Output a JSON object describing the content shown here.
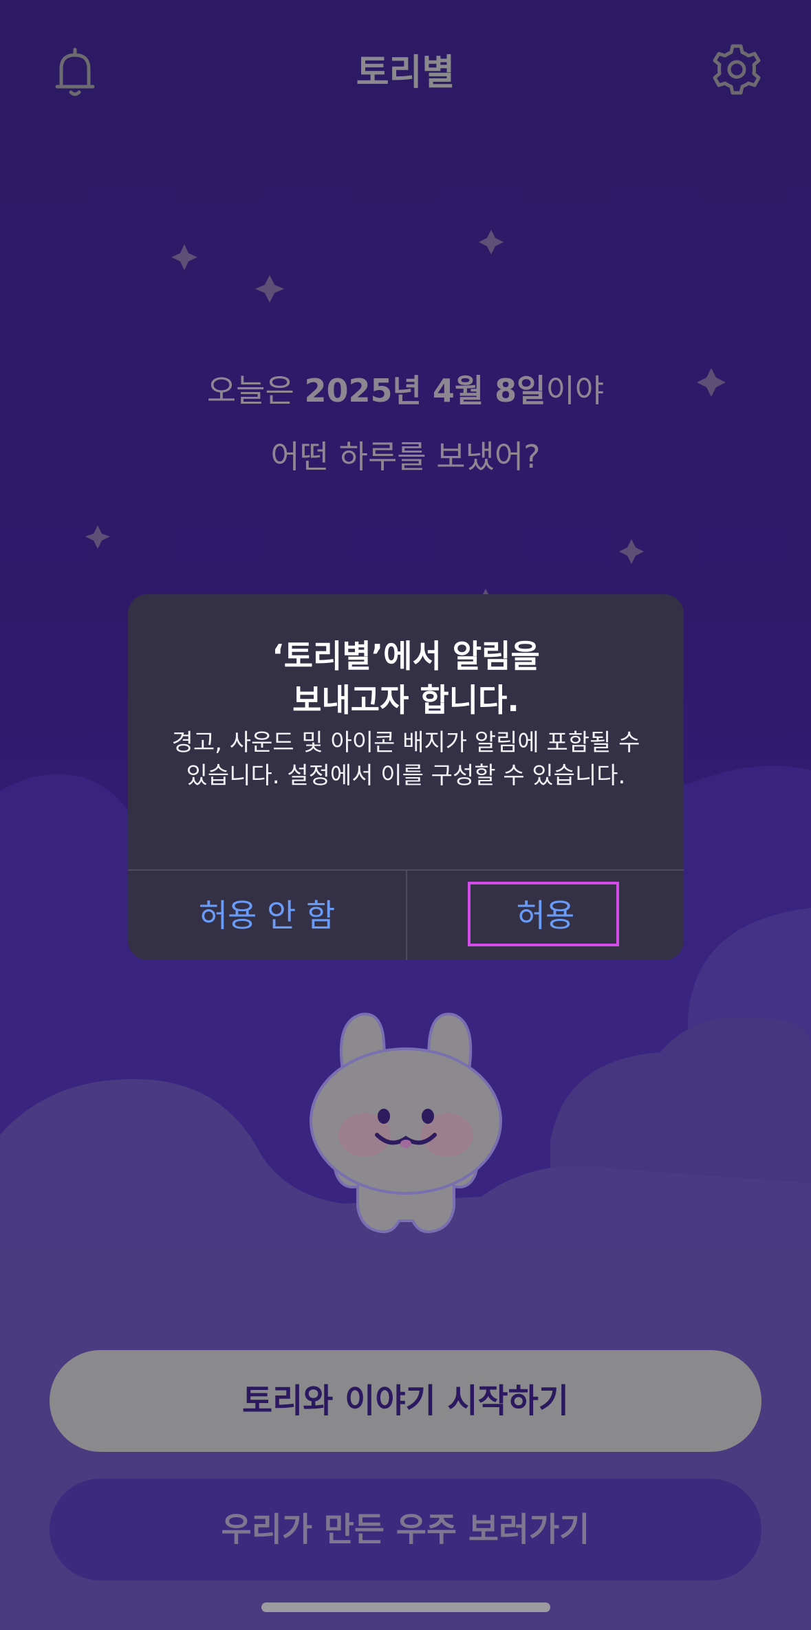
{
  "app": {
    "title": "토리별"
  },
  "greeting": {
    "line1_prefix": "오늘은 ",
    "line1_date": "2025년 4월 8일",
    "line1_suffix": "이야",
    "line2": "어떤 하루를 보냈어?"
  },
  "alert": {
    "title_line1": "‘토리별’에서 알림을",
    "title_line2": "보내고자 합니다.",
    "message": "경고, 사운드 및 아이콘 배지가 알림에 포함될 수 있습니다. 설정에서 이를 구성할 수 있습니다.",
    "deny_label": "허용 안 함",
    "allow_label": "허용"
  },
  "actions": {
    "primary_label": "토리와 이야기 시작하기",
    "secondary_label": "우리가 만든 우주 보러가기"
  },
  "icons": {
    "left": "bell-icon",
    "right": "gear-icon"
  },
  "colors": {
    "background": "#2f1a6b",
    "dialog": "#343046",
    "dialog_button": "#6a9cf7",
    "highlight": "#d24de8",
    "primary_button": "#8a8a8c"
  }
}
